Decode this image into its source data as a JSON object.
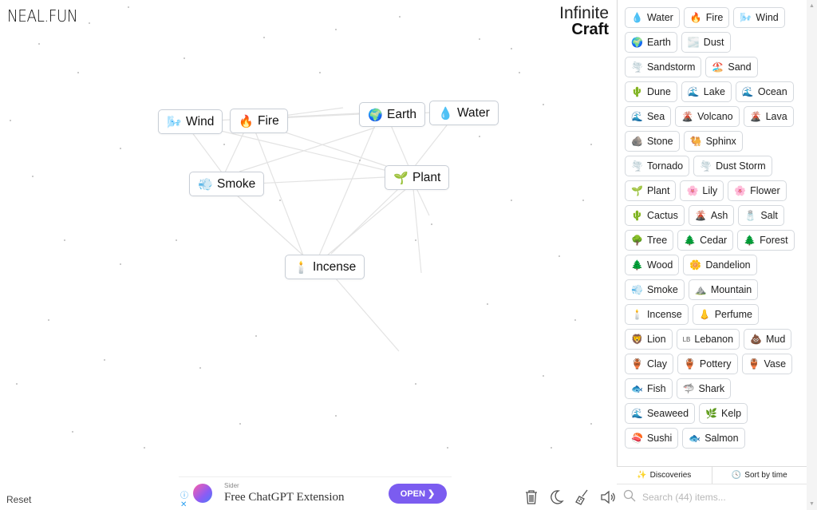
{
  "header": {
    "site_logo": "NEAL.FUN",
    "brand_line1": "Infinite",
    "brand_line2": "Craft"
  },
  "canvas": {
    "nodes": [
      {
        "label": "Wind",
        "icon": "🌬️",
        "icon_name": "wind-icon"
      },
      {
        "label": "Fire",
        "icon": "🔥",
        "icon_name": "fire-icon"
      },
      {
        "label": "Earth",
        "icon": "🌍",
        "icon_name": "earth-icon"
      },
      {
        "label": "Water",
        "icon": "💧",
        "icon_name": "water-icon"
      },
      {
        "label": "Smoke",
        "icon": "💨",
        "icon_name": "smoke-icon"
      },
      {
        "label": "Plant",
        "icon": "🌱",
        "icon_name": "plant-icon"
      },
      {
        "label": "Incense",
        "icon": "🕯️",
        "icon_name": "incense-icon"
      }
    ],
    "reset_label": "Reset"
  },
  "ad": {
    "info_icon": "ⓘ",
    "close_icon": "✕",
    "sponsor": "Sider",
    "headline": "Free ChatGPT Extension",
    "cta": "OPEN ❯"
  },
  "toolbar": {
    "icons": [
      "trash-icon",
      "moon-icon",
      "broom-icon",
      "speaker-icon"
    ]
  },
  "sidebar": {
    "items": [
      {
        "label": "Water",
        "icon": "💧"
      },
      {
        "label": "Fire",
        "icon": "🔥"
      },
      {
        "label": "Wind",
        "icon": "🌬️"
      },
      {
        "label": "Earth",
        "icon": "🌍"
      },
      {
        "label": "Dust",
        "icon": "🌫️"
      },
      {
        "label": "Sandstorm",
        "icon": "🌪️"
      },
      {
        "label": "Sand",
        "icon": "🏖️"
      },
      {
        "label": "Dune",
        "icon": "🌵"
      },
      {
        "label": "Lake",
        "icon": "🌊"
      },
      {
        "label": "Ocean",
        "icon": "🌊"
      },
      {
        "label": "Sea",
        "icon": "🌊"
      },
      {
        "label": "Volcano",
        "icon": "🌋"
      },
      {
        "label": "Lava",
        "icon": "🌋"
      },
      {
        "label": "Stone",
        "icon": "🪨"
      },
      {
        "label": "Sphinx",
        "icon": "🐫"
      },
      {
        "label": "Tornado",
        "icon": "🌪️"
      },
      {
        "label": "Dust Storm",
        "icon": "🌪️"
      },
      {
        "label": "Plant",
        "icon": "🌱"
      },
      {
        "label": "Lily",
        "icon": "🌸"
      },
      {
        "label": "Flower",
        "icon": "🌸"
      },
      {
        "label": "Cactus",
        "icon": "🌵"
      },
      {
        "label": "Ash",
        "icon": "🌋"
      },
      {
        "label": "Salt",
        "icon": "🧂"
      },
      {
        "label": "Tree",
        "icon": "🌳"
      },
      {
        "label": "Cedar",
        "icon": "🌲"
      },
      {
        "label": "Forest",
        "icon": "🌲"
      },
      {
        "label": "Wood",
        "icon": "🌲"
      },
      {
        "label": "Dandelion",
        "icon": "🌼"
      },
      {
        "label": "Smoke",
        "icon": "💨"
      },
      {
        "label": "Mountain",
        "icon": "⛰️"
      },
      {
        "label": "Incense",
        "icon": "🕯️"
      },
      {
        "label": "Perfume",
        "icon": "👃"
      },
      {
        "label": "Lion",
        "icon": "🦁"
      },
      {
        "label": "Lebanon",
        "icon": "LB"
      },
      {
        "label": "Mud",
        "icon": "💩"
      },
      {
        "label": "Clay",
        "icon": "🏺"
      },
      {
        "label": "Pottery",
        "icon": "🏺"
      },
      {
        "label": "Vase",
        "icon": "🏺"
      },
      {
        "label": "Fish",
        "icon": "🐟"
      },
      {
        "label": "Shark",
        "icon": "🦈"
      },
      {
        "label": "Seaweed",
        "icon": "🌊"
      },
      {
        "label": "Kelp",
        "icon": "🌿"
      },
      {
        "label": "Sushi",
        "icon": "🍣"
      },
      {
        "label": "Salmon",
        "icon": "🐟"
      }
    ],
    "tabs": {
      "discoveries": "Discoveries",
      "sort": "Sort by time"
    },
    "search_placeholder": "Search (44) items..."
  }
}
